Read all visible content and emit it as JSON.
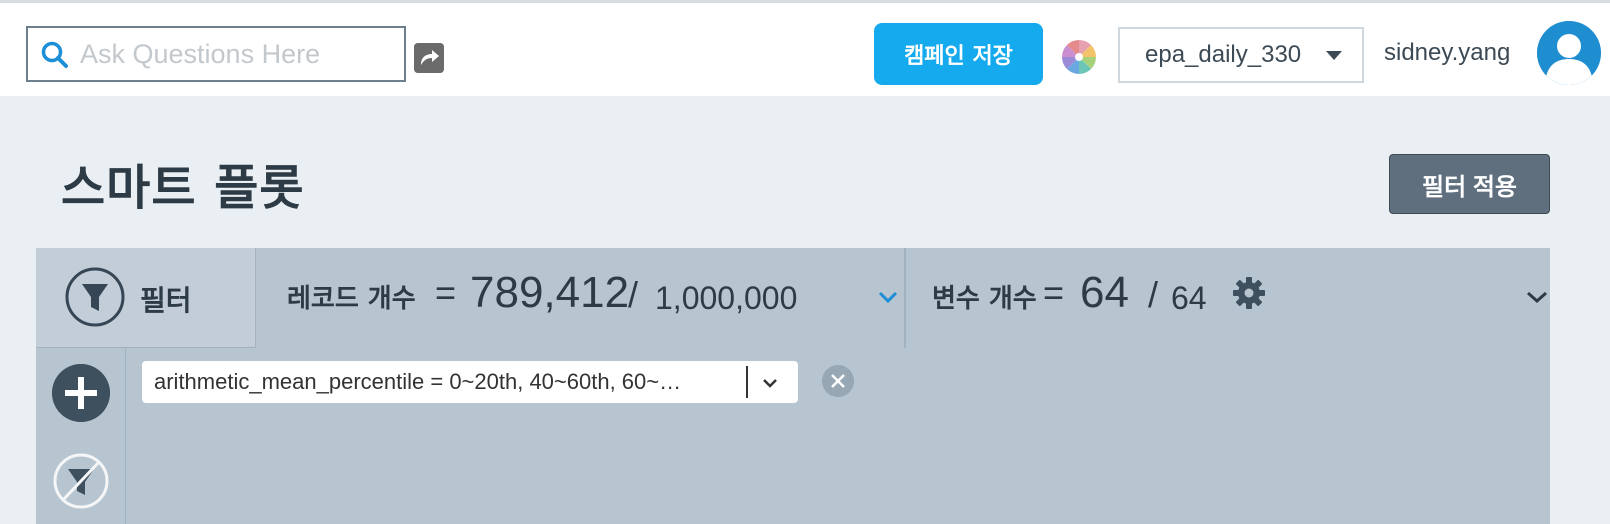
{
  "header": {
    "search_placeholder": "Ask Questions Here",
    "save_campaign_label": "캠페인 저장",
    "dataset_selected": "epa_daily_330",
    "username": "sidney.yang",
    "accent_color": "#14aaed"
  },
  "page": {
    "title": "스마트 플롯",
    "apply_filter_label": "필터 적용"
  },
  "panel": {
    "filter_tab_label": "필터",
    "records": {
      "label": "레코드 개수",
      "equals": "=",
      "count": "789,412",
      "slash": "/",
      "total": "1,000,000"
    },
    "variables": {
      "label": "변수 개수",
      "equals": "=",
      "count": "64",
      "slash": "/",
      "total": "64"
    },
    "active_filters": [
      {
        "text": "arithmetic_mean_percentile = 0~20th, 40~60th, 60~…"
      }
    ]
  }
}
